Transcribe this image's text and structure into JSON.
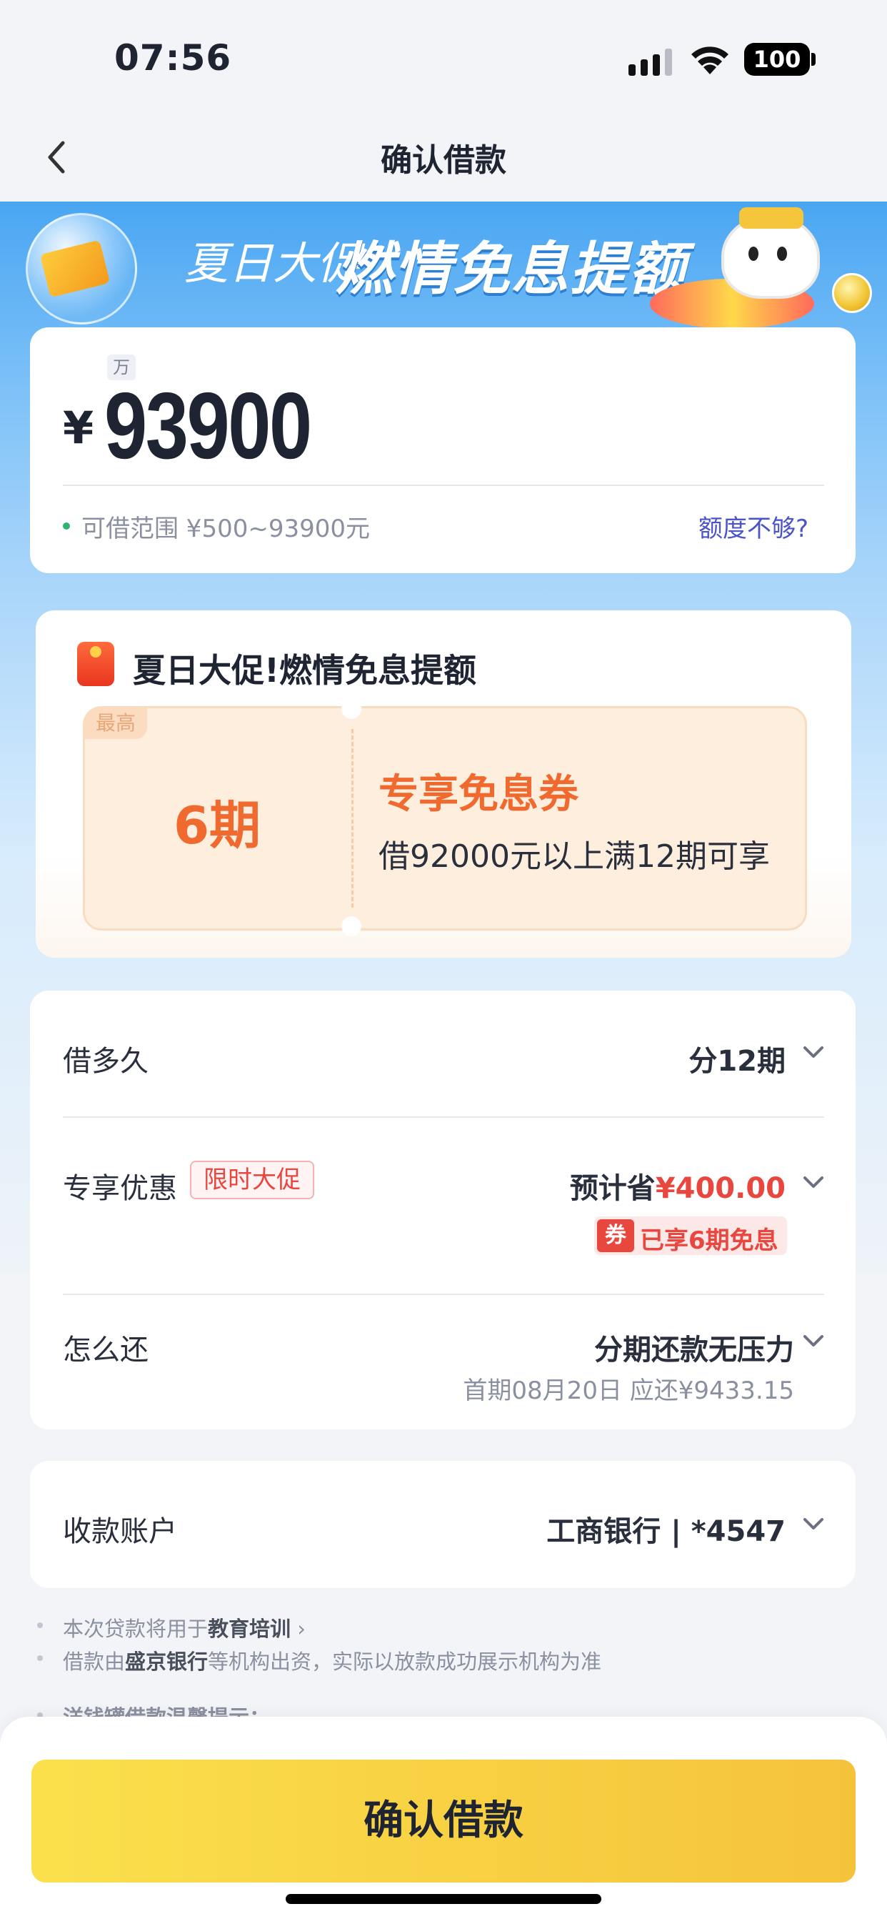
{
  "status_bar": {
    "time": "07:56",
    "battery": "100"
  },
  "nav": {
    "title": "确认借款"
  },
  "banner": {
    "small_text": "夏日大促",
    "big_text": "燃情免息提额"
  },
  "amount": {
    "unit_badge": "万",
    "currency": "¥",
    "value": "93900",
    "range": "可借范围 ¥500~93900元",
    "not_enough": "额度不够?"
  },
  "promo": {
    "title": "夏日大促!燃情免息提额",
    "max_badge": "最高",
    "periods": "6期",
    "coupon_name": "专享免息券",
    "coupon_desc": "借92000元以上满12期可享"
  },
  "details": {
    "term_label": "借多久",
    "term_value": "分12期",
    "discount_label": "专享优惠",
    "discount_tag": "限时大促",
    "discount_prefix": "预计省",
    "discount_amount": "¥400.00",
    "coupon_tag_icon": "券",
    "coupon_tag_text": "已享6期免息",
    "repay_label": "怎么还",
    "repay_value": "分期还款无压力",
    "first_due": "首期08月20日 应还¥9433.15"
  },
  "account": {
    "label": "收款账户",
    "value": "工商银行 | *4547"
  },
  "notes": {
    "purpose_prefix": "本次贷款将用于",
    "purpose_value": "教育培训",
    "funder_prefix": "借款由",
    "funder_bank": "盛京银行",
    "funder_suffix": "等机构出资，实际以放款成功展示机构为准",
    "tips": "洋钱罐借款温馨提示："
  },
  "confirm_button": "确认借款",
  "colors": {
    "accent_orange": "#f06a2f",
    "accent_red": "#e8473f",
    "button_yellow": "#f5c33a",
    "link_blue": "#4b55c8"
  }
}
